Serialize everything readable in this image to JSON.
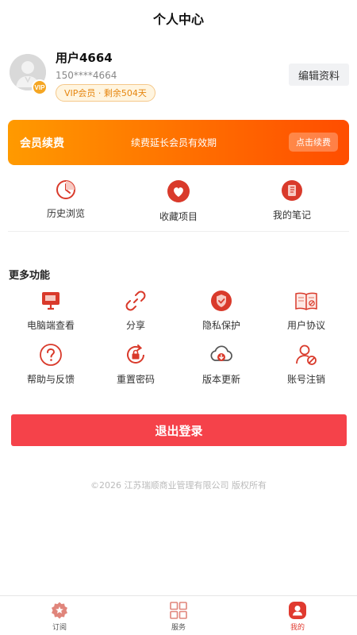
{
  "header": {
    "title": "个人中心"
  },
  "profile": {
    "name": "用户4664",
    "phone": "150****4664",
    "vip_badge": "VIP会员 · 剩余504天",
    "vip_dot": "VIP",
    "edit_label": "编辑资料"
  },
  "banner": {
    "title": "会员续费",
    "subtitle": "续费延长会员有效期",
    "button": "点击续费"
  },
  "quick_links": [
    {
      "label": "历史浏览",
      "icon": "history-icon"
    },
    {
      "label": "收藏项目",
      "icon": "heart-icon"
    },
    {
      "label": "我的笔记",
      "icon": "notebook-icon"
    }
  ],
  "more": {
    "title": "更多功能",
    "items": [
      {
        "label": "电脑端查看",
        "icon": "monitor-icon"
      },
      {
        "label": "分享",
        "icon": "link-icon"
      },
      {
        "label": "隐私保护",
        "icon": "shield-icon"
      },
      {
        "label": "用户协议",
        "icon": "book-icon"
      },
      {
        "label": "帮助与反馈",
        "icon": "help-icon"
      },
      {
        "label": "重置密码",
        "icon": "lock-reset-icon"
      },
      {
        "label": "版本更新",
        "icon": "cloud-download-icon"
      },
      {
        "label": "账号注销",
        "icon": "user-cancel-icon"
      }
    ]
  },
  "logout": {
    "label": "退出登录"
  },
  "footer": {
    "copyright": "©2026 江苏瑞顺商业管理有限公司 版权所有"
  },
  "tabbar": {
    "items": [
      {
        "label": "订阅",
        "icon": "star-badge-icon",
        "active": false
      },
      {
        "label": "服务",
        "icon": "grid-icon",
        "active": false
      },
      {
        "label": "我的",
        "icon": "user-icon",
        "active": true
      }
    ]
  },
  "colors": {
    "accent": "#e03a2f",
    "banner_start": "#ff9a00",
    "banner_end": "#ff4d00",
    "logout": "#f5424a",
    "vip_gold": "#f5a623"
  }
}
